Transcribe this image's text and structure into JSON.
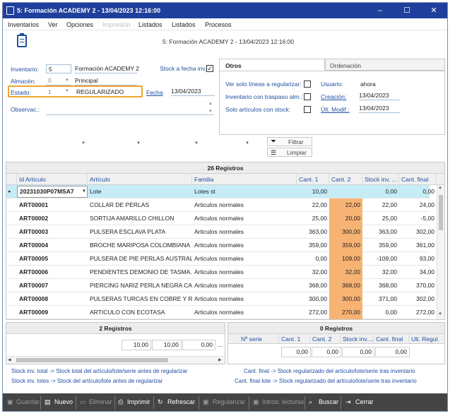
{
  "window": {
    "title": "5: Formación ACADEMY 2 - 13/04/2023 12:16:00",
    "min": "–",
    "max": "☐",
    "close": "✕"
  },
  "menu": [
    "Inventarios",
    "Ver",
    "Opciones",
    "Impresión",
    "Listados",
    "Listados",
    "Procesos"
  ],
  "header_caption": "5: Formación ACADEMY 2 - 13/04/2023 12:16:00",
  "form": {
    "inventario_label": "Inventario:",
    "inventario_value": "5",
    "inventario_name": "Formación ACADEMY 2",
    "stock_fecha_label": "Stock a fecha inv.",
    "stock_fecha_checked": "✓",
    "almacen_label": "Almacén:",
    "almacen_value": "0",
    "almacen_name": "Principal",
    "estado_label": "Estado:",
    "estado_value": "1",
    "estado_name": "REGULARIZADO",
    "fecha_label": "Fecha",
    "fecha_value": "13/04/2023",
    "observ_label": "Observac.:"
  },
  "tabs": {
    "otros": "Otros",
    "ordenacion": "Ordenación",
    "ver_solo_label": "Ver solo líneas a regularizar:",
    "traspaso_label": "Inventario con traspaso alm.:",
    "con_stock_label": "Solo artículos con stock:",
    "usuario_label": "Usuario:",
    "usuario_value": "ahora",
    "creacion_label": "Creación:",
    "creacion_value": "13/04/2023",
    "ultmodif_label": "Últ. Modif.:",
    "ultmodif_value": "13/04/2023"
  },
  "actions": {
    "filtrar": "Filtrar",
    "limpiar": "Limpiar"
  },
  "main_grid": {
    "count": "26 Registros",
    "headers": [
      "Id Artículo",
      "Artículo",
      "Familia",
      "Cant. 1",
      "Cant. 2",
      "Stock inv. ...",
      "Cant. final"
    ],
    "rows": [
      [
        "20231030P07MSA7",
        "Lote",
        "Lotes st",
        "10,00",
        "",
        "0,00",
        "0,00"
      ],
      [
        "ART00001",
        "COLLAR DE PERLAS",
        "Articulos normales",
        "22,00",
        "22,00",
        "22,00",
        "24,00"
      ],
      [
        "ART00002",
        "SORTIJA AMARILLO CHILLON",
        "Articulos normales",
        "25,00",
        "20,00",
        "25,00",
        "-5,00"
      ],
      [
        "ART00003",
        "PULSERA ESCLAVA PLATA",
        "Articulos normales",
        "363,00",
        "300,00",
        "363,00",
        "302,00"
      ],
      [
        "ART00004",
        "BROCHE MARIPOSA COLOMBIANA",
        "Articulos normales",
        "359,00",
        "359,00",
        "359,00",
        "361,00"
      ],
      [
        "ART00005",
        "PULSERA DE PIE PERLAS AUSTRALI...",
        "Articulos normales",
        "0,00",
        "109,00",
        "-109,00",
        "93,00"
      ],
      [
        "ART00006",
        "PENDIENTES DEMONIO DE TASMA...",
        "Articulos normales",
        "32,00",
        "32,00",
        "32,00",
        "34,00"
      ],
      [
        "ART00007",
        "PIERCING NARIZ PERLA NEGRA CAP...",
        "Articulos normales",
        "368,00",
        "368,00",
        "368,00",
        "370,00"
      ],
      [
        "ART00008",
        "PULSERAS TURCAS EN COBRE Y RO...",
        "Articulos normales",
        "300,00",
        "300,00",
        "371,00",
        "302,00"
      ],
      [
        "ART00009",
        "ARTICULO CON ECOTASA",
        "Articulos normales",
        "272,00",
        "270,00",
        "0,00",
        "272,00"
      ]
    ]
  },
  "sub_left": {
    "count": "2 Registros",
    "values": [
      "10,00",
      "10,00",
      "0,00"
    ],
    "more": "..."
  },
  "sub_right": {
    "count": "0 Registros",
    "headers": [
      "Nº serie",
      "Cant. 1",
      "Cant. 2",
      "Stock inv....",
      "Cant. final",
      "Ult. Regul."
    ],
    "values": [
      "0,00",
      "0,00",
      "0,00",
      "0,00"
    ]
  },
  "legends": {
    "l1": "Stock inv. total -> Stock total del artículo/lote/serie antes de regularizar",
    "l2": "Stock inv. lotes -> Stock del artículo/lote antes de regularizar",
    "r1": "Cant. final -> Stock regularizado del artículo/lote/serie tras inventario",
    "r2": "Cant. final lote -> Stock regularizado del artículo/lote/serie tras inventario"
  },
  "toolbar": [
    "Guardar",
    "Nuevo",
    "Eliminar",
    "Imprimir",
    "Refrescar",
    "Regularizar",
    "Introd. lecturas",
    "Buscar",
    "Cerrar"
  ],
  "colors": {
    "titlebar": "#1e3f9b",
    "orange": "#f7b374",
    "selected_row": "#c6ecf6",
    "highlight_border": "#f0a52c"
  }
}
